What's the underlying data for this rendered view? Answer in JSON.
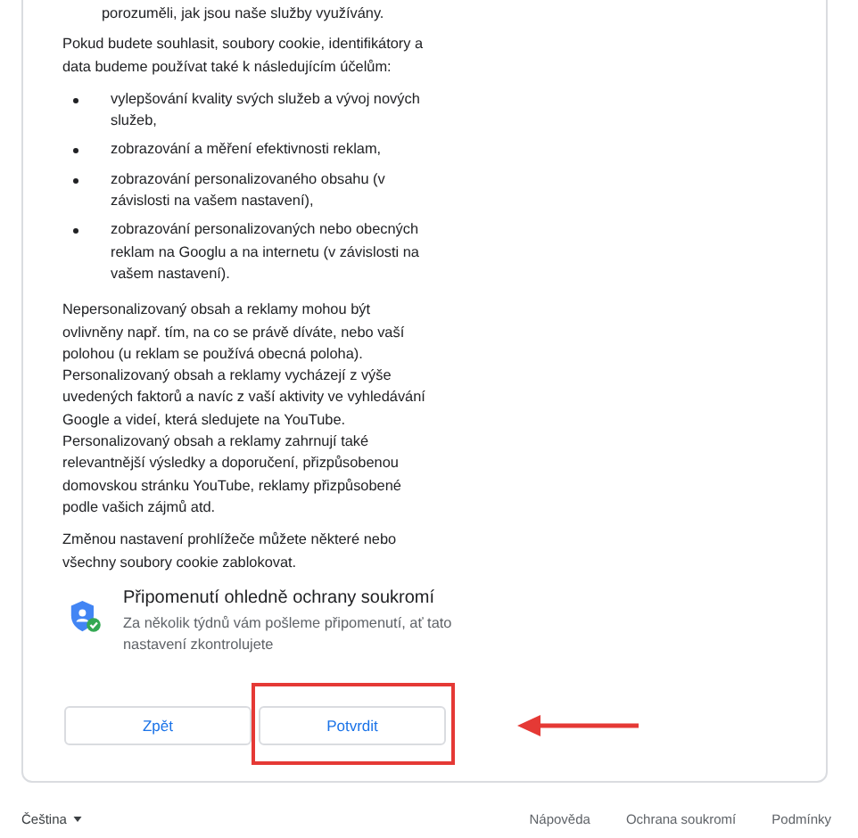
{
  "intro_tail": "porozuměli, jak jsou naše služby využívány.",
  "purposes_intro": "Pokud budete souhlasit, soubory cookie, identifikátory a data budeme používat také k následujícím účelům:",
  "purposes": [
    "vylepšování kvality svých služeb a vývoj nových služeb,",
    "zobrazování a měření efektivnosti reklam,",
    "zobrazování personalizovaného obsahu (v závislosti na vašem nastavení),",
    "zobrazování personalizovaných nebo obecných reklam na Googlu a na internetu (v závislosti na vašem nastavení)."
  ],
  "personalization_note": "Nepersonalizovaný obsah a reklamy mohou být ovlivněny např. tím, na co se právě díváte, nebo vaší polohou (u reklam se používá obecná poloha). Personalizovaný obsah a reklamy vycházejí z výše uvedených faktorů a navíc z vaší aktivity ve vyhledávání Google a videí, která sledujete na YouTube. Personalizovaný obsah a reklamy zahrnují také relevantnější výsledky a doporučení, přizpůsobenou domovskou stránku YouTube, reklamy přizpůsobené podle vašich zájmů atd.",
  "browser_note": "Změnou nastavení prohlížeče můžete některé nebo všechny soubory cookie zablokovat.",
  "reminder": {
    "title": "Připomenutí ohledně ochrany soukromí",
    "text": "Za několik týdnů vám pošleme připomenutí, ať tato nastavení zkontrolujete"
  },
  "buttons": [
    "Zpět",
    "Potvrdit"
  ],
  "footer": {
    "language": "Čeština",
    "links": [
      "Nápověda",
      "Ochrana soukromí",
      "Podmínky"
    ]
  }
}
